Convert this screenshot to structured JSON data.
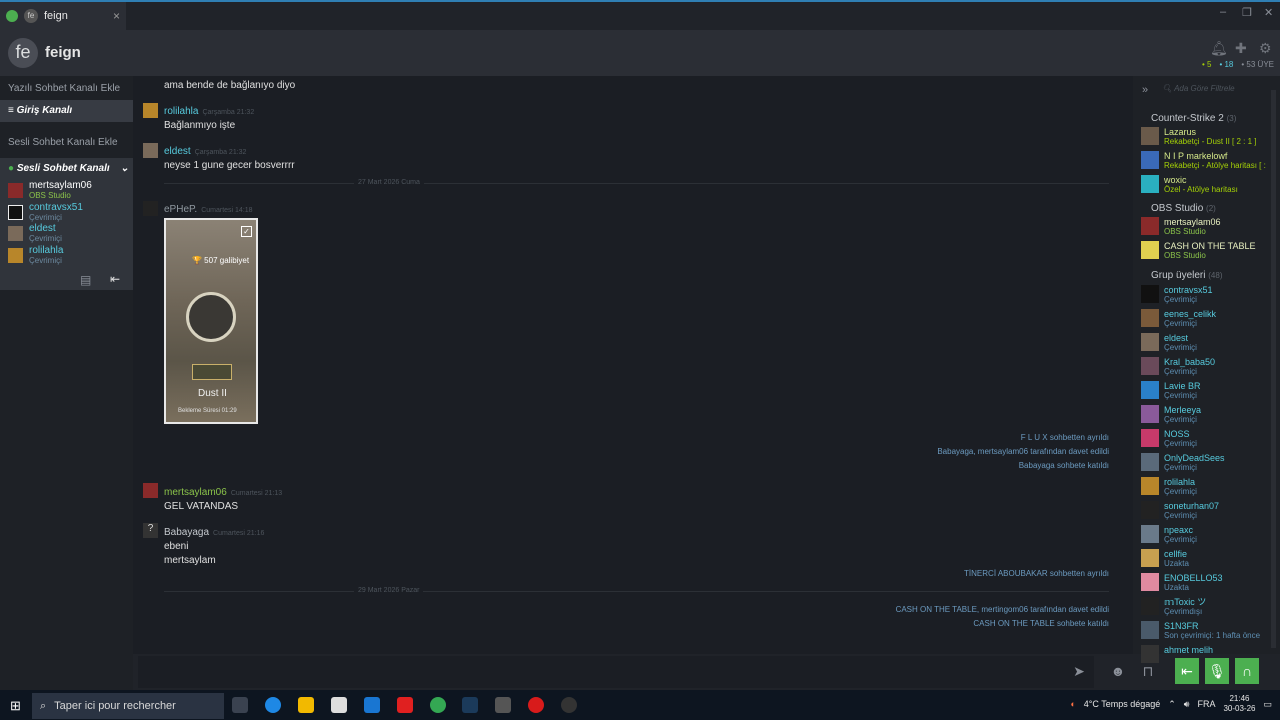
{
  "window": {
    "tab_title": "feign",
    "tab_close": "×",
    "btn_min": "–",
    "btn_max": "❐",
    "btn_close": "✕"
  },
  "header": {
    "avatar_text": "fe",
    "group_name": "feign",
    "count_online": "5",
    "count_ingame": "18",
    "count_members": "53 ÜYE"
  },
  "sidebar": {
    "add_text_channel": "Yazılı Sohbet Kanalı Ekle",
    "text_channel": "Giriş Kanalı",
    "add_voice_channel": "Sesli Sohbet Kanalı Ekle",
    "voice_channel": "Sesli Sohbet Kanalı",
    "voice_users": [
      {
        "name": "mertsaylam06",
        "status": "OBS Studio"
      },
      {
        "name": "contravsx51",
        "status": "Çevrimiçi"
      },
      {
        "name": "eldest",
        "status": "Çevrimiçi"
      },
      {
        "name": "rolilahla",
        "status": "Çevrimiçi"
      }
    ]
  },
  "chat": {
    "m0_text": "ama bende de bağlanıyo diyo",
    "m1_name": "rolilahla",
    "m1_time": "Çarşamba 21:32",
    "m1_text": "Bağlanmıyo işte",
    "m2_name": "eldest",
    "m2_time": "Çarşamba 21:32",
    "m2_text": "neyse 1 gune gecer bosverrrr",
    "div1": "27 Mart 2026 Cuma",
    "m3_name": "ePHeP.",
    "m3_time": "Cumartesi 14:18",
    "card_badge": "🏆 507 galibiyet",
    "card_map": "Dust II",
    "card_duration": "Bekleme Süresi 01:29",
    "sys1": "F L U X sohbetten ayrıldı",
    "sys2": "Babayaga, mertsaylam06 tarafından davet edildi",
    "sys3": "Babayaga sohbete katıldı",
    "m4_name": "mertsaylam06",
    "m4_time": "Cumartesi 21:13",
    "m4_text": "GEL VATANDAS",
    "m5_name": "Babayaga",
    "m5_time": "Cumartesi 21:16",
    "m5_text1": "ebeni",
    "m5_text2": "mertsaylam",
    "sys4": "TİNERCİ ABOUBAKAR sohbetten ayrıldı",
    "div2": "29 Mart 2026 Pazar",
    "sys5": "CASH ON THE TABLE, mertingom06 tarafından davet edildi",
    "sys6": "CASH ON THE TABLE sohbete katıldı"
  },
  "members": {
    "filter_placeholder": "Ada Göre Filtrele",
    "g1": "Counter-Strike 2",
    "g1_count": "(3)",
    "g1_users": [
      {
        "name": "Lazarus",
        "status": "Rekabetçi - Dust II [ 2 : 1 ]"
      },
      {
        "name": "N I P markelowf",
        "status": "Rekabetçi - Atölye haritası [ :"
      },
      {
        "name": "woxic",
        "status": "Özel - Atölye haritası"
      }
    ],
    "g2": "OBS Studio",
    "g2_count": "(2)",
    "g2_users": [
      {
        "name": "mertsaylam06",
        "status": "OBS Studio"
      },
      {
        "name": "CASH ON THE TABLE",
        "status": "OBS Studio"
      }
    ],
    "g3": "Grup üyeleri",
    "g3_count": "(48)",
    "g3_users": [
      {
        "name": "contravsx51",
        "status": "Çevrimiçi"
      },
      {
        "name": "eenes_celikk",
        "status": "Çevrimiçi"
      },
      {
        "name": "eldest",
        "status": "Çevrimiçi"
      },
      {
        "name": "Kral_baba50",
        "status": "Çevrimiçi"
      },
      {
        "name": "Lavie BR",
        "status": "Çevrimiçi"
      },
      {
        "name": "Merleeya",
        "status": "Çevrimiçi"
      },
      {
        "name": "NOSS",
        "status": "Çevrimiçi"
      },
      {
        "name": "OnlyDeadSees",
        "status": "Çevrimiçi"
      },
      {
        "name": "rolilahla",
        "status": "Çevrimiçi"
      },
      {
        "name": "soneturhan07",
        "status": "Çevrimiçi"
      },
      {
        "name": "npeaxc",
        "status": "Çevrimiçi"
      },
      {
        "name": "cellfie",
        "status": "Uzakta"
      },
      {
        "name": "ENOBELLO53",
        "status": "Uzakta"
      },
      {
        "name": "𝕞Toxic ツ",
        "status": "Çevrimdışı"
      },
      {
        "name": "S1N3FR",
        "status": "Son çevrimiçi: 1 hafta önce"
      },
      {
        "name": "ahmet melih",
        "status": ""
      }
    ]
  },
  "taskbar": {
    "search_placeholder": "Taper ici pour rechercher",
    "weather": "4°C  Temps dégagé",
    "lang": "FRA",
    "time": "21:46",
    "date": "30-03-26"
  },
  "colors": {
    "online": "#57cbde",
    "ingame": "#a4d007",
    "accent_green": "#4caf50"
  }
}
